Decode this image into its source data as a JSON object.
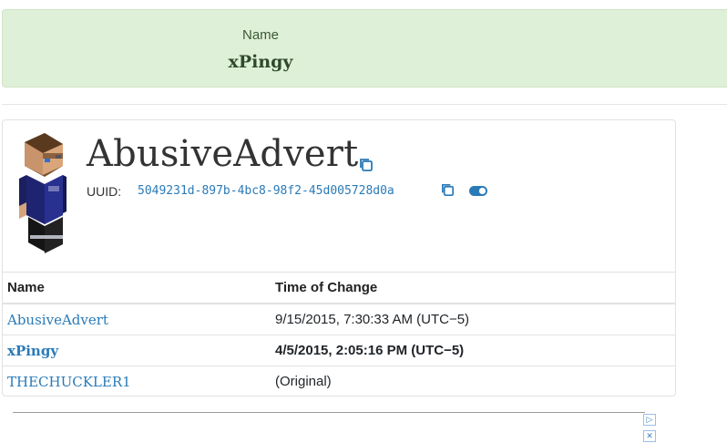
{
  "banner": {
    "label": "Name",
    "value": "xPingy"
  },
  "profile": {
    "name": "AbusiveAdvert",
    "uuid_label": "UUID:",
    "uuid": "5049231d-897b-4bc8-98f2-45d005728d0a"
  },
  "history": {
    "headers": [
      "Name",
      "Time of Change"
    ],
    "rows": [
      {
        "name": "AbusiveAdvert",
        "time": "9/15/2015, 7:30:33 AM (UTC−5)"
      },
      {
        "name": "xPingy",
        "time": "4/5/2015, 2:05:16 PM (UTC−5)"
      },
      {
        "name": "THECHUCKLER1",
        "time": "(Original)"
      }
    ]
  },
  "ad": {
    "badges": [
      "▷",
      "✕"
    ]
  },
  "icons": [
    "copy-icon",
    "toggle-icon",
    "ad-choices-icon",
    "close-icon"
  ],
  "colors": {
    "banner_bg": "#dff0d8",
    "link": "#2a7ab8"
  }
}
